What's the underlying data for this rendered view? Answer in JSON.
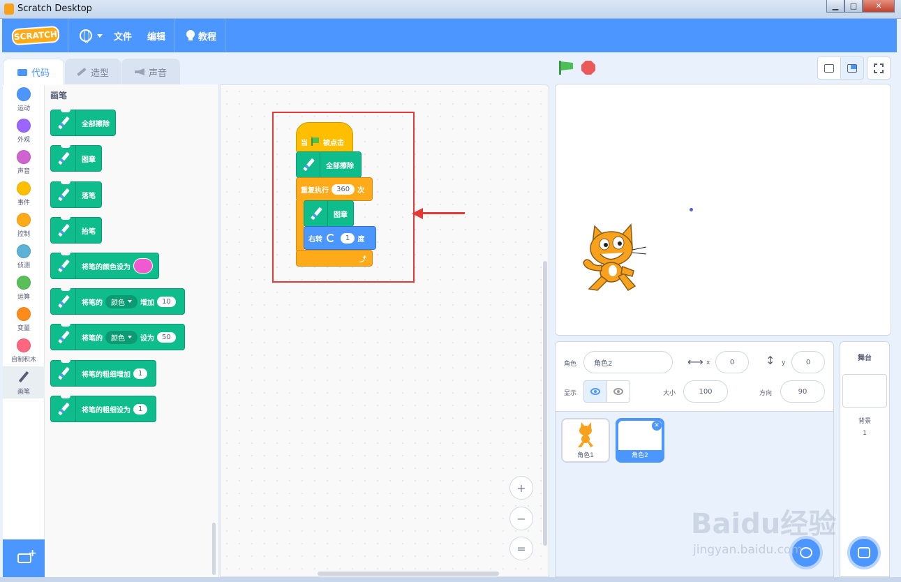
{
  "window": {
    "title": "Scratch Desktop",
    "controls": {
      "minimize": "▁",
      "maximize": "□",
      "close": "✕"
    }
  },
  "menubar": {
    "logo": "SCRATCH",
    "file": "文件",
    "edit": "编辑",
    "tutorials": "教程"
  },
  "tabs": [
    {
      "label": "代码",
      "active": true
    },
    {
      "label": "造型",
      "active": false
    },
    {
      "label": "声音",
      "active": false
    }
  ],
  "categories": [
    {
      "label": "运动",
      "color": "#4c97ff"
    },
    {
      "label": "外观",
      "color": "#9966ff"
    },
    {
      "label": "声音",
      "color": "#cf63cf"
    },
    {
      "label": "事件",
      "color": "#ffbf00"
    },
    {
      "label": "控制",
      "color": "#ffab19"
    },
    {
      "label": "侦测",
      "color": "#5cb1d6"
    },
    {
      "label": "运算",
      "color": "#59c059"
    },
    {
      "label": "变量",
      "color": "#ff8c1a"
    },
    {
      "label": "自制积木",
      "color": "#ff6680"
    },
    {
      "label": "画笔",
      "color": "#0fbd8c",
      "selected": true
    }
  ],
  "palette": {
    "title": "画笔",
    "blocks": {
      "clear": "全部擦除",
      "stamp": "图章",
      "pen_down": "落笔",
      "pen_up": "抬笔",
      "set_color_to": "将笔的颜色设为",
      "change_param_prefix": "将笔的",
      "param_option": "颜色",
      "change_by": "增加",
      "change_value": "10",
      "set_to": "设为",
      "set_value": "50",
      "change_size": "将笔的粗细增加",
      "change_size_value": "1",
      "set_size": "将笔的粗细设为",
      "set_size_value": "1",
      "pen_color": "#f05ad0"
    }
  },
  "script": {
    "when_flag_prefix": "当",
    "when_flag_suffix": "被点击",
    "clear": "全部擦除",
    "repeat_label": "重复执行",
    "repeat_count": "360",
    "repeat_suffix": "次",
    "stamp": "图章",
    "turn_label": "右转",
    "turn_value": "1",
    "turn_suffix": "度",
    "loop_end_arrow": "⤴"
  },
  "zoom": {
    "in": "+",
    "out": "−",
    "reset": "="
  },
  "sprite_info": {
    "sprite_label": "角色",
    "sprite_name": "角色2",
    "x_label": "x",
    "x_value": "0",
    "y_label": "y",
    "y_value": "0",
    "show_label": "显示",
    "size_label": "大小",
    "size_value": "100",
    "direction_label": "方向",
    "direction_value": "90"
  },
  "sprites": [
    {
      "name": "角色1",
      "selected": false
    },
    {
      "name": "角色2",
      "selected": true
    }
  ],
  "stage_pane": {
    "title": "舞台",
    "backdrop_label": "背景",
    "backdrop_count": "1"
  },
  "watermark": {
    "main": "Baidu经验",
    "sub": "jingyan.baidu.com"
  }
}
